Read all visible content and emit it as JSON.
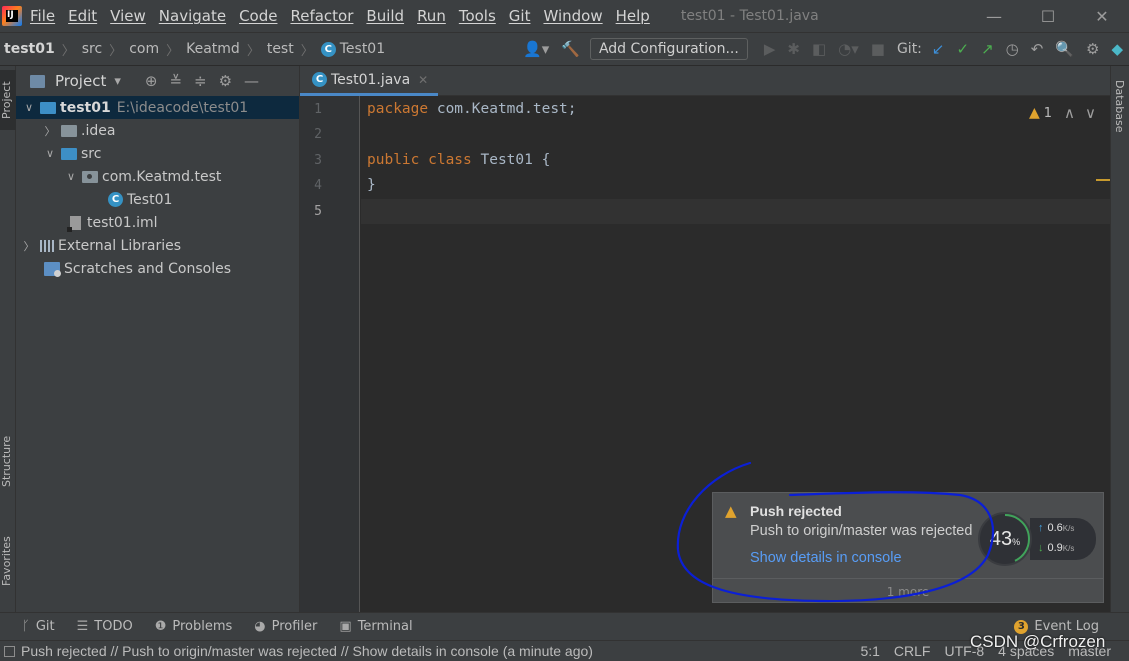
{
  "menubar": {
    "items": [
      "File",
      "Edit",
      "View",
      "Navigate",
      "Code",
      "Refactor",
      "Build",
      "Run",
      "Tools",
      "Git",
      "Window",
      "Help"
    ],
    "window_title": "test01 - Test01.java",
    "controls": [
      "—",
      "☐",
      "✕"
    ]
  },
  "navbar": {
    "crumbs": [
      "test01",
      "src",
      "com",
      "Keatmd",
      "test",
      "Test01"
    ],
    "add_configuration": "Add Configuration...",
    "git_label": "Git:"
  },
  "left_stripe": {
    "project_tab": "Project",
    "structure_tab": "Structure",
    "favorites_tab": "Favorites"
  },
  "project_panel": {
    "title": "Project",
    "tree": [
      {
        "label": "test01",
        "path": "E:\\ideacode\\test01"
      },
      {
        "label": ".idea"
      },
      {
        "label": "src"
      },
      {
        "label": "com.Keatmd.test"
      },
      {
        "label": "Test01"
      },
      {
        "label": "test01.iml"
      },
      {
        "label": "External Libraries"
      },
      {
        "label": "Scratches and Consoles"
      }
    ]
  },
  "editor": {
    "tab_label": "Test01.java",
    "line_numbers": [
      "1",
      "2",
      "3",
      "4",
      "5"
    ],
    "code": {
      "line1_kw": "package",
      "line1_rest": " com.Keatmd.test;",
      "line3_kw": "public class",
      "line3_rest": " Test01 {",
      "line4": "}"
    },
    "warning_count": "1"
  },
  "right_stripe": {
    "database_tab": "Database"
  },
  "notification": {
    "title": "Push rejected",
    "body": "Push to origin/master was rejected",
    "link": "Show details in console",
    "more": "1 more"
  },
  "speed_widget": {
    "percent": "43",
    "percent_sign": "%",
    "up": "0.6",
    "down": "0.9",
    "unit": "K/s"
  },
  "tool_windows": {
    "git": "Git",
    "todo": "TODO",
    "problems": "Problems",
    "profiler": "Profiler",
    "terminal": "Terminal",
    "event_log": "Event Log",
    "event_count": "3"
  },
  "statusbar": {
    "message": "Push rejected // Push to origin/master was rejected // Show details in console (a minute ago)",
    "position": "5:1",
    "line_sep": "CRLF",
    "encoding": "UTF-8",
    "indent": "4 spaces",
    "branch": "master"
  },
  "watermark": "CSDN @Crfrozen",
  "colors": {
    "keyword": "#cc7832",
    "link": "#589df6",
    "warning": "#e0a32e",
    "selection": "#0d293e",
    "scribble": "#0b1fd6"
  }
}
